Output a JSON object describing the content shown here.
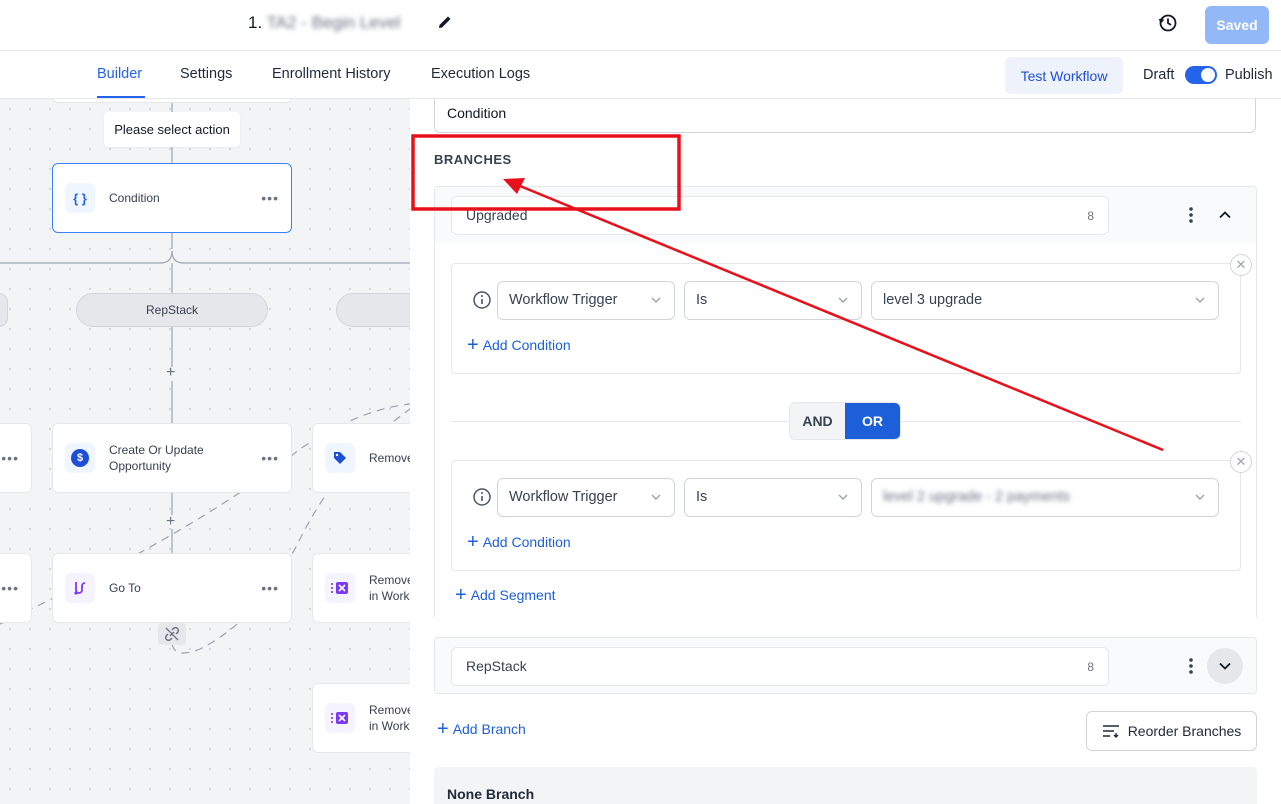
{
  "header": {
    "title_prefix": "1. ",
    "title_blurred": "TA2 - Begin Level",
    "saved_label": "Saved"
  },
  "tabs": [
    {
      "label": "Builder",
      "active": true
    },
    {
      "label": "Settings"
    },
    {
      "label": "Enrollment History"
    },
    {
      "label": "Execution Logs"
    }
  ],
  "toolbar": {
    "test_label": "Test Workflow",
    "draft_label": "Draft",
    "publish_label": "Publish",
    "publish_on": true
  },
  "canvas": {
    "tooltip": "Please select action",
    "condition_node": "Condition",
    "branch_pill": "RepStack",
    "opportunity_node": [
      "Create Or Update",
      "Opportunity"
    ],
    "goto_node": "Go To",
    "remove_node_1": "Remove",
    "remove_node_2": [
      "Remove",
      "in Work"
    ],
    "remove_node_3": [
      "Remove",
      "in Work"
    ]
  },
  "panel": {
    "condition_field": "Condition",
    "branches_heading": "BRANCHES",
    "branch1": {
      "name": "Upgraded",
      "count": "8",
      "segments": [
        {
          "field": "Workflow Trigger",
          "operator": "Is",
          "value": "level 3 upgrade",
          "add_condition": "Add Condition"
        },
        {
          "field": "Workflow Trigger",
          "operator": "Is",
          "value_blurred": "level 2 upgrade - 2 payments",
          "add_condition": "Add Condition"
        }
      ],
      "and_label": "AND",
      "or_label": "OR",
      "add_segment": "Add Segment"
    },
    "branch2": {
      "name": "RepStack",
      "count": "8"
    },
    "add_branch": "Add Branch",
    "reorder_label": "Reorder Branches",
    "none_branch": "None Branch"
  },
  "colors": {
    "accent": "#2563eb",
    "annotation_red": "#e8101a"
  }
}
